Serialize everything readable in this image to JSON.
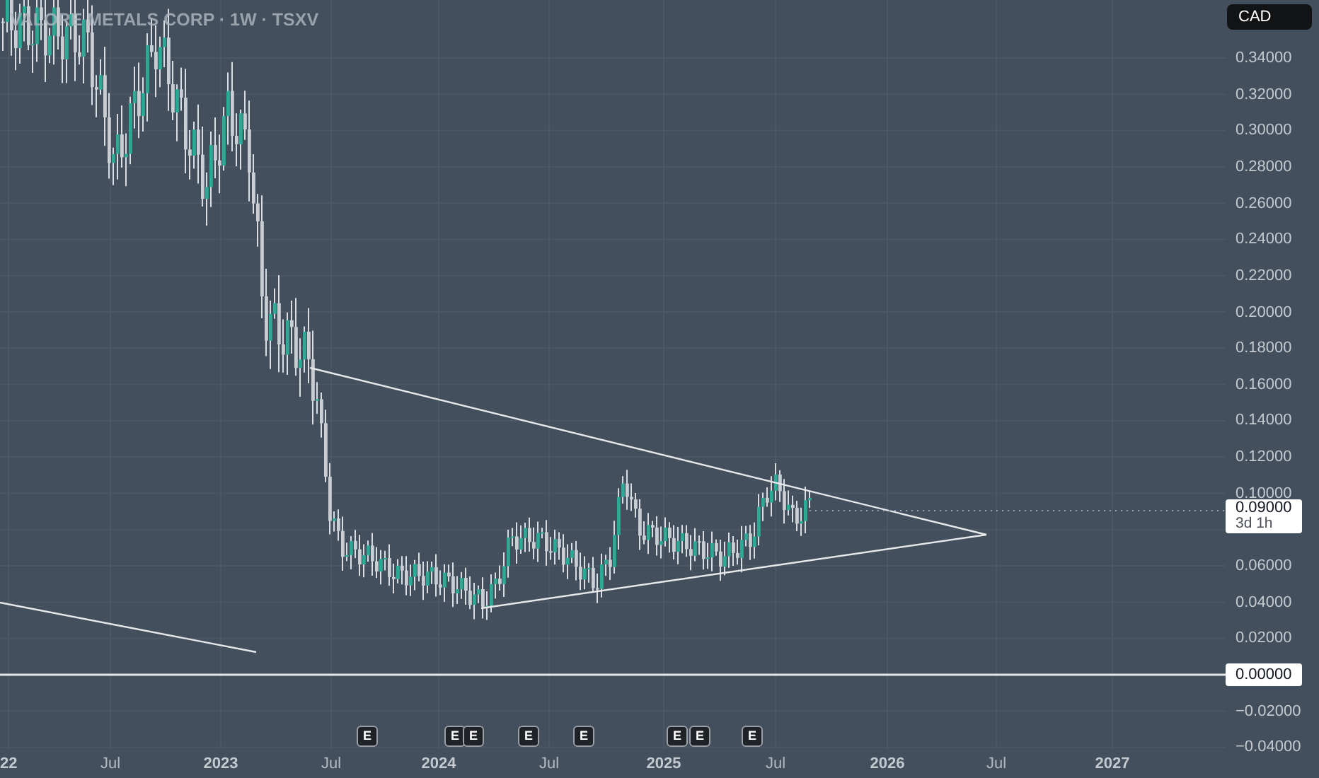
{
  "symbol_title": "VALORE METALS CORP · 1W · TSXV",
  "currency": "CAD",
  "price_axis": {
    "labels": [
      "0.34000",
      "0.32000",
      "0.30000",
      "0.28000",
      "0.26000",
      "0.24000",
      "0.22000",
      "0.20000",
      "0.18000",
      "0.16000",
      "0.14000",
      "0.12000",
      "0.10000",
      "0.06000",
      "0.04000",
      "0.02000",
      "−0.02000",
      "−0.04000"
    ]
  },
  "current_price": {
    "value": "0.09000",
    "countdown": "3d 1h"
  },
  "zero_line_label": "0.00000",
  "time_axis": {
    "labels": [
      {
        "text": "22",
        "kind": "year"
      },
      {
        "text": "Jul",
        "kind": "month"
      },
      {
        "text": "2023",
        "kind": "year"
      },
      {
        "text": "Jul",
        "kind": "month"
      },
      {
        "text": "2024",
        "kind": "year"
      },
      {
        "text": "Jul",
        "kind": "month"
      },
      {
        "text": "2025",
        "kind": "year"
      },
      {
        "text": "Jul",
        "kind": "month"
      },
      {
        "text": "2026",
        "kind": "year"
      },
      {
        "text": "Jul",
        "kind": "month"
      },
      {
        "text": "2027",
        "kind": "year"
      }
    ]
  },
  "earnings_markers": [
    "E",
    "E",
    "E",
    "E",
    "E",
    "E",
    "E",
    "E"
  ]
}
